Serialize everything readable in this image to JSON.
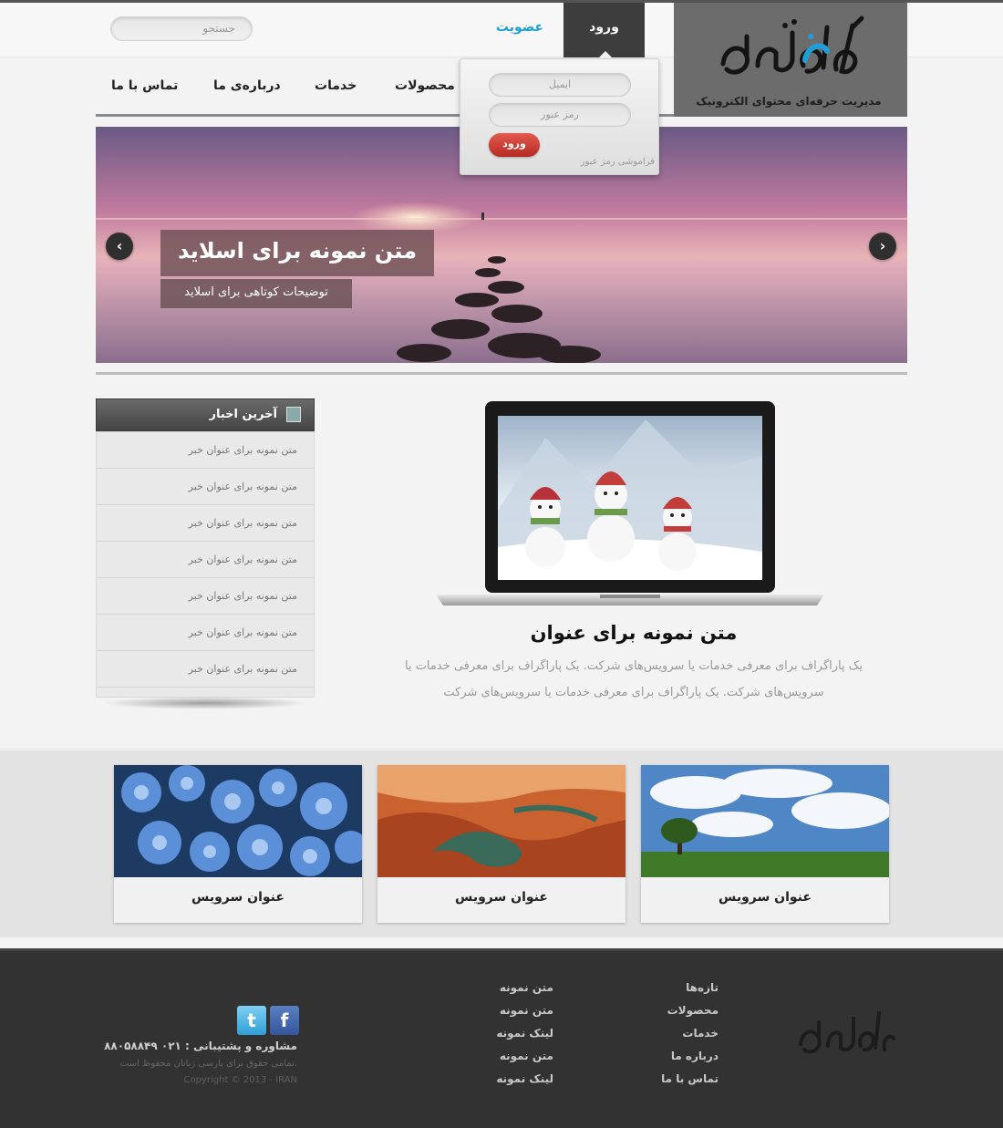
{
  "header": {
    "search_placeholder": "جستجو",
    "signup_label": "عضویت",
    "login_tab_label": "ورود",
    "logo_tagline": "مدیریت حرفه‌ای محتوای الکترونیک"
  },
  "nav": {
    "items": [
      "تماس با ما",
      "درباره‌ی ما",
      "خدمات",
      "محصولات"
    ]
  },
  "login_form": {
    "email_placeholder": "ایمیل",
    "password_placeholder": "رمز عبور",
    "submit_label": "ورود",
    "forgot_label": "فراموشی رمز عبور"
  },
  "slider": {
    "title": "متن نمونه برای اسلاید",
    "description": "توضیحات کوتاهی برای اسلاید",
    "prev_icon": "chevron-left-icon",
    "next_icon": "chevron-right-icon"
  },
  "news": {
    "heading": "آخرین اخبار",
    "items": [
      "متن نمونه برای عنوان خبر",
      "متن نمونه برای عنوان خبر",
      "متن نمونه برای عنوان خبر",
      "متن نمونه برای عنوان خبر",
      "متن نمونه برای عنوان خبر",
      "متن نمونه برای عنوان خبر",
      "متن نمونه برای عنوان خبر"
    ]
  },
  "feature": {
    "title": "متن نمونه برای عنوان",
    "text": "یک پاراگراف برای معرفی خدمات یا سرویس‌های شرکت.  یک پاراگراف برای معرفی خدمات یا سرویس‌های شرکت. یک پاراگراف برای معرفی خدمات یا سرویس‌های شرکت"
  },
  "services": [
    {
      "label": "عنوان سرویس"
    },
    {
      "label": "عنوان سرویس"
    },
    {
      "label": "عنوان سرویس"
    }
  ],
  "footer": {
    "col1": [
      "تازه‌ها",
      "محصولات",
      "خدمات",
      "درباره ما",
      "تماس با ما"
    ],
    "col2": [
      "متن نمونه",
      "متن نمونه",
      "لینک نمونه",
      "متن نمونه",
      "لینک نمونه"
    ],
    "support": "مشاوره و پشتیبانی : ۰۲۱ ۸۸۰۵۸۸۴۹",
    "rights": "تمامی حقوق برای پارسی زبانان محفوظ است.",
    "copyright": "Copyright © 2013 - IRAN"
  },
  "colors": {
    "accent_blue": "#1e9fd8",
    "login_red": "#c9382e",
    "dark": "#3d3d3d"
  }
}
